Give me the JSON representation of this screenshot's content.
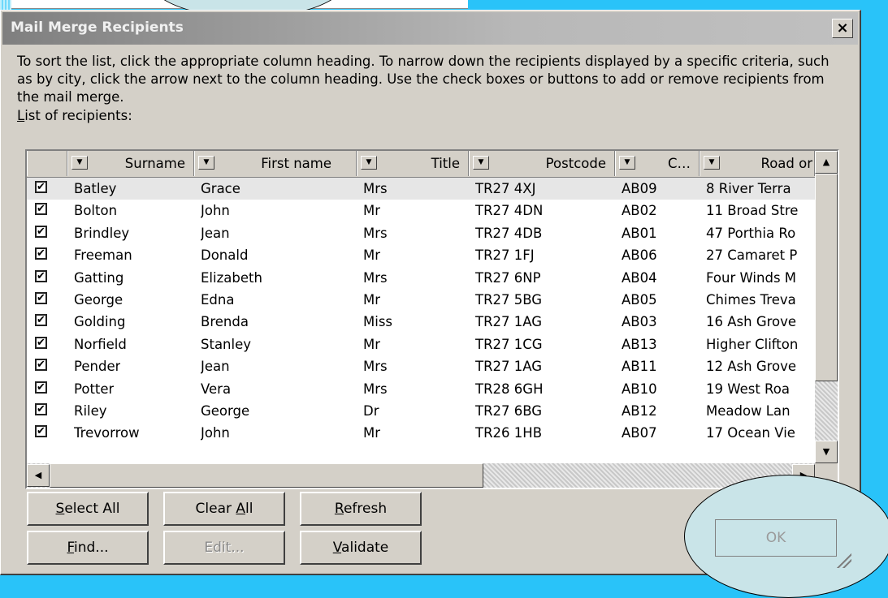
{
  "window": {
    "title": "Mail Merge Recipients",
    "close_glyph": "×"
  },
  "description": "To sort the list, click the appropriate column heading.  To narrow down the recipients displayed by a specific criteria, such as by city, click the arrow next to the column heading.  Use the check boxes or buttons to add or remove recipients from the mail merge.",
  "list_label": {
    "accel": "L",
    "rest": "ist of recipients:"
  },
  "columns": [
    "Surname",
    "First name",
    "Title",
    "Postcode",
    "C…",
    "Road or"
  ],
  "rows": [
    {
      "checked": true,
      "surname": "Batley",
      "first_name": "Grace",
      "title": "Mrs",
      "postcode": "TR27 4XJ",
      "c": "AB09",
      "road": "8 River Terra"
    },
    {
      "checked": true,
      "surname": "Bolton",
      "first_name": "John",
      "title": "Mr",
      "postcode": "TR27 4DN",
      "c": "AB02",
      "road": "11 Broad Stre"
    },
    {
      "checked": true,
      "surname": "Brindley",
      "first_name": "Jean",
      "title": "Mrs",
      "postcode": "TR27 4DB",
      "c": "AB01",
      "road": "47 Porthia Ro"
    },
    {
      "checked": true,
      "surname": "Freeman",
      "first_name": "Donald",
      "title": "Mr",
      "postcode": "TR27 1FJ",
      "c": "AB06",
      "road": "27 Camaret P"
    },
    {
      "checked": true,
      "surname": "Gatting",
      "first_name": "Elizabeth",
      "title": "Mrs",
      "postcode": "TR27 6NP",
      "c": "AB04",
      "road": "Four Winds M"
    },
    {
      "checked": true,
      "surname": "George",
      "first_name": "Edna",
      "title": "Mr",
      "postcode": "TR27 5BG",
      "c": "AB05",
      "road": "Chimes Treva"
    },
    {
      "checked": true,
      "surname": "Golding",
      "first_name": "Brenda",
      "title": "Miss",
      "postcode": "TR27 1AG",
      "c": "AB03",
      "road": "16 Ash Grove"
    },
    {
      "checked": true,
      "surname": "Norfield",
      "first_name": "Stanley",
      "title": "Mr",
      "postcode": "TR27 1CG",
      "c": "AB13",
      "road": "Higher Clifton"
    },
    {
      "checked": true,
      "surname": "Pender",
      "first_name": "Jean",
      "title": "Mrs",
      "postcode": "TR27 1AG",
      "c": "AB11",
      "road": "12 Ash Grove"
    },
    {
      "checked": true,
      "surname": "Potter",
      "first_name": "Vera",
      "title": "Mrs",
      "postcode": "TR28 6GH",
      "c": "AB10",
      "road": "19 West Roa"
    },
    {
      "checked": true,
      "surname": "Riley",
      "first_name": "George",
      "title": "Dr",
      "postcode": "TR27 6BG",
      "c": "AB12",
      "road": "Meadow Lan"
    },
    {
      "checked": true,
      "surname": "Trevorrow",
      "first_name": "John",
      "title": "Mr",
      "postcode": "TR26 1HB",
      "c": "AB07",
      "road": "17 Ocean Vie"
    }
  ],
  "buttons": {
    "select_all": {
      "accel": "S",
      "rest": "elect All"
    },
    "clear_all": {
      "pre": "Clear ",
      "accel": "A",
      "rest": "ll"
    },
    "refresh": {
      "accel": "R",
      "rest": "efresh"
    },
    "find": {
      "accel": "F",
      "rest": "ind..."
    },
    "edit": "Edit...",
    "validate": {
      "accel": "V",
      "rest": "alidate"
    },
    "ok": "OK"
  },
  "glyphs": {
    "check": "✔",
    "header_arrow": "▼",
    "up": "▲",
    "down": "▼",
    "left": "◀",
    "right": "▶"
  }
}
